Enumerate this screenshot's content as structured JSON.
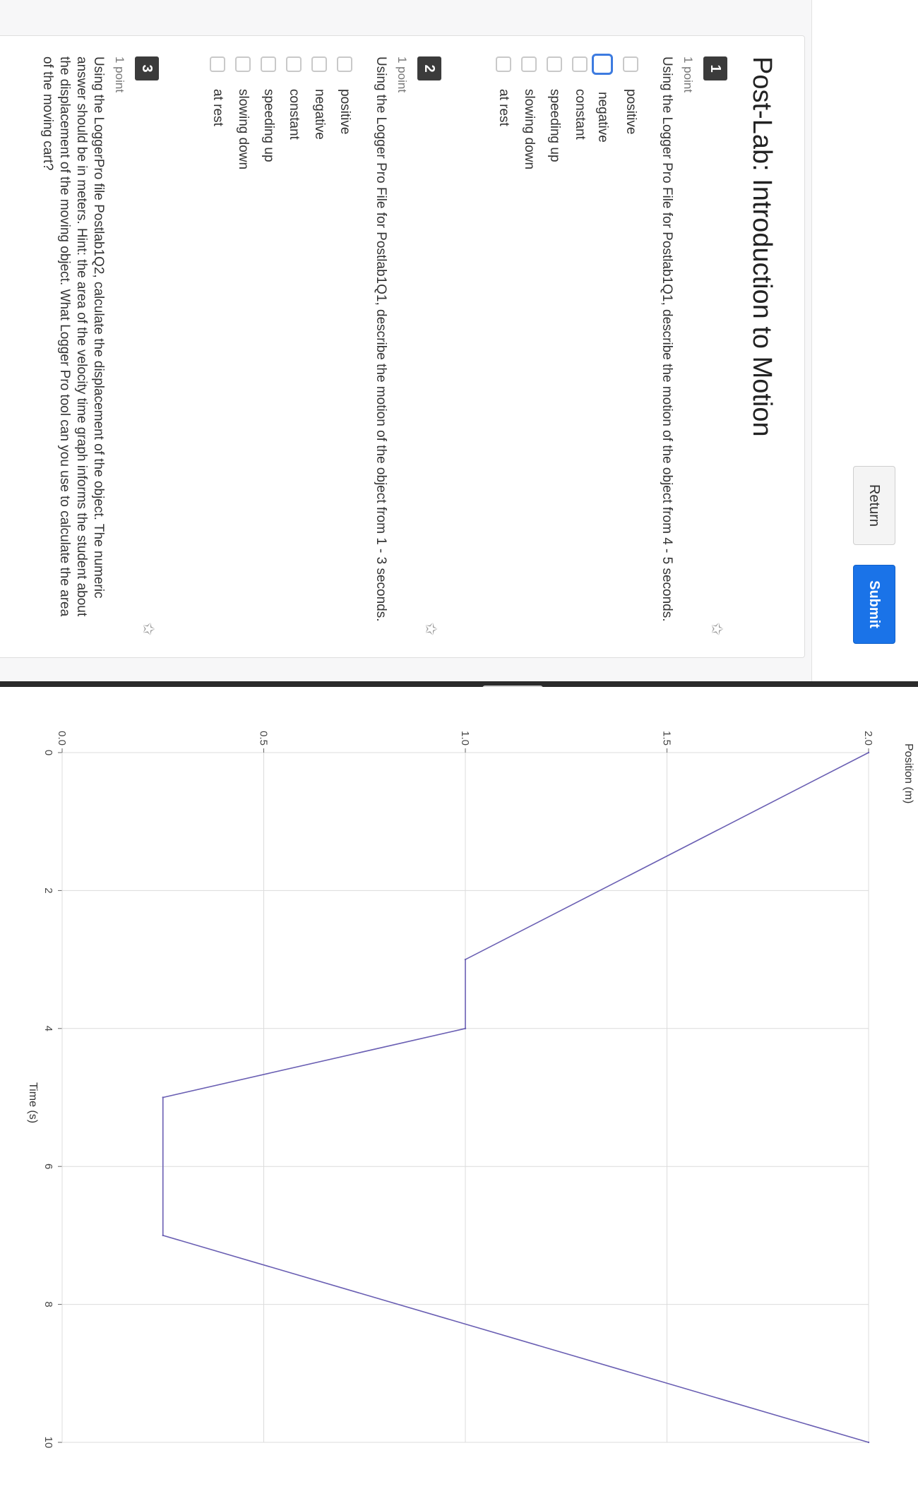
{
  "toolbar": {
    "return_label": "Return",
    "submit_label": "Submit"
  },
  "page": {
    "title": "Post-Lab: Introduction to Motion"
  },
  "questions": [
    {
      "number": "1",
      "points": "1 point",
      "text": "Using the Logger Pro File for Postlab1Q1, describe the motion of the object from 4 - 5 seconds.",
      "options": [
        "positive",
        "negative",
        "constant",
        "speeding up",
        "slowing down",
        "at rest"
      ]
    },
    {
      "number": "2",
      "points": "1 point",
      "text": "Using the Logger Pro File for Postlab1Q1, describe the motion of the object from 1 - 3 seconds.",
      "options": [
        "positive",
        "negative",
        "constant",
        "speeding up",
        "slowing down",
        "at rest"
      ]
    },
    {
      "number": "3",
      "points": "1 point",
      "text": "Using the LoggerPro file Postlab1Q2, calculate the displacement of the object. The numeric answer should be in meters. Hint: the area of the velocity time graph informs the student about the displacement of the moving object. What Logger Pro tool can you use to calculate the area of the moving cart?"
    }
  ],
  "chart_data": {
    "type": "line",
    "xlabel": "Time (s)",
    "ylabel": "Position (m)",
    "xlim": [
      0,
      10
    ],
    "ylim": [
      0,
      2
    ],
    "xticks": [
      "0",
      "2",
      "4",
      "6",
      "8",
      "10"
    ],
    "yticks": [
      "0.0",
      "0.5",
      "1.0",
      "1.5",
      "2.0"
    ],
    "series": [
      {
        "x": [
          0,
          3,
          4,
          5,
          7,
          10
        ],
        "y": [
          2.0,
          1.0,
          1.0,
          0.25,
          0.25,
          2.0
        ]
      }
    ],
    "grid": true,
    "line_color": "#6a5fb3"
  }
}
